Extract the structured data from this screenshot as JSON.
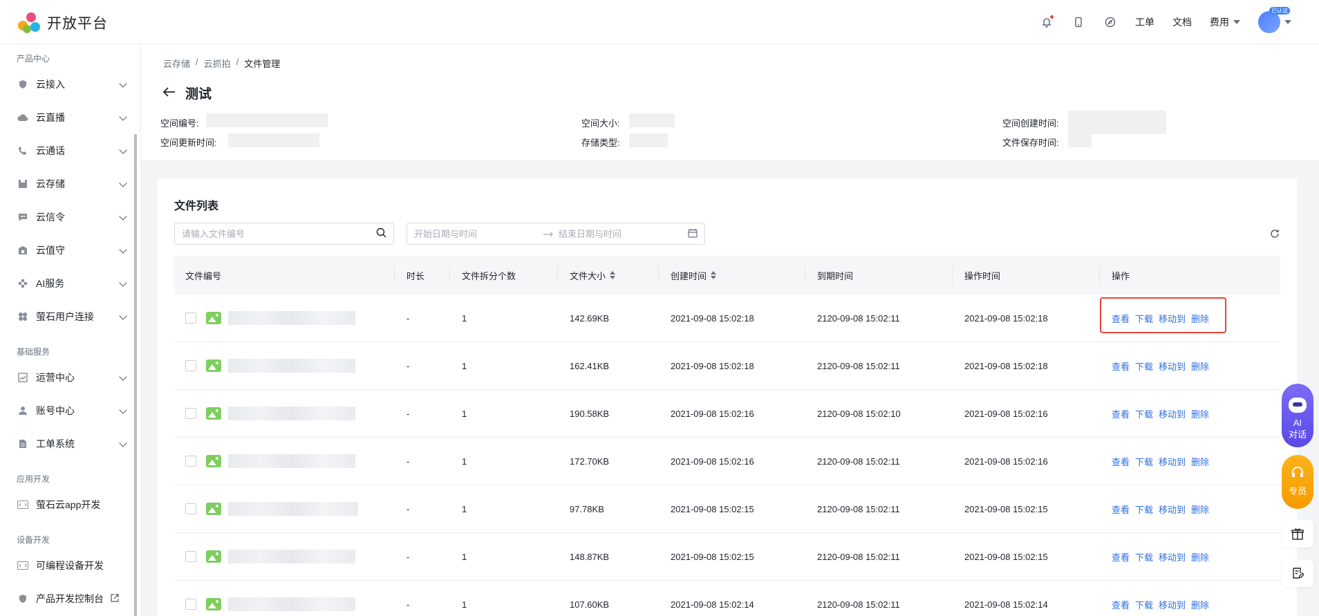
{
  "header": {
    "logo_text": "开放平台",
    "ticket": "工单",
    "docs": "文档",
    "fees": "费用",
    "avatar_badge": "已认证"
  },
  "sidebar": {
    "sections": {
      "product": "产品中心",
      "basic": "基础服务",
      "app": "应用开发",
      "device": "设备开发"
    },
    "items": [
      {
        "label": "云接入",
        "icon": "shield-icon"
      },
      {
        "label": "云直播",
        "icon": "cloud-icon"
      },
      {
        "label": "云通话",
        "icon": "phone-icon"
      },
      {
        "label": "云存储",
        "icon": "save-icon"
      },
      {
        "label": "云信令",
        "icon": "message-icon"
      },
      {
        "label": "云值守",
        "icon": "lock-icon"
      },
      {
        "label": "AI服务",
        "icon": "ai-icon"
      },
      {
        "label": "萤石用户连接",
        "icon": "apps-icon"
      },
      {
        "label": "运营中心",
        "icon": "chart-icon"
      },
      {
        "label": "账号中心",
        "icon": "user-icon"
      },
      {
        "label": "工单系统",
        "icon": "doc-icon"
      },
      {
        "label": "萤石云app开发",
        "icon": "code-icon"
      },
      {
        "label": "可编程设备开发",
        "icon": "code-icon"
      },
      {
        "label": "产品开发控制台",
        "icon": "shield-icon"
      }
    ]
  },
  "breadcrumb": [
    "云存储",
    "云抓拍",
    "文件管理"
  ],
  "page_title": "测试",
  "info": {
    "space_id": "空间编号:",
    "space_size": "空间大小:",
    "space_created": "空间创建时间:",
    "space_updated": "空间更新时间:",
    "storage_type": "存储类型:",
    "file_retention": "文件保存时间:"
  },
  "card": {
    "title": "文件列表",
    "search_placeholder": "请输入文件编号",
    "start_placeholder": "开始日期与时间",
    "end_placeholder": "结束日期与时间"
  },
  "table": {
    "headers": {
      "file_id": "文件编号",
      "duration": "时长",
      "split_count": "文件拆分个数",
      "size": "文件大小",
      "created": "创建时间",
      "expire": "到期时间",
      "op_time": "操作时间",
      "actions": "操作"
    },
    "action_labels": {
      "view": "查看",
      "download": "下载",
      "move": "移动到",
      "delete": "删除"
    },
    "rows": [
      {
        "duration": "-",
        "split": "1",
        "size": "142.69KB",
        "created": "2021-09-08 15:02:18",
        "expire": "2120-09-08 15:02:11",
        "op": "2021-09-08 15:02:18"
      },
      {
        "duration": "-",
        "split": "1",
        "size": "162.41KB",
        "created": "2021-09-08 15:02:18",
        "expire": "2120-09-08 15:02:11",
        "op": "2021-09-08 15:02:18"
      },
      {
        "duration": "-",
        "split": "1",
        "size": "190.58KB",
        "created": "2021-09-08 15:02:16",
        "expire": "2120-09-08 15:02:10",
        "op": "2021-09-08 15:02:16"
      },
      {
        "duration": "-",
        "split": "1",
        "size": "172.70KB",
        "created": "2021-09-08 15:02:16",
        "expire": "2120-09-08 15:02:11",
        "op": "2021-09-08 15:02:16"
      },
      {
        "duration": "-",
        "split": "1",
        "size": "97.78KB",
        "created": "2021-09-08 15:02:15",
        "expire": "2120-09-08 15:02:11",
        "op": "2021-09-08 15:02:15"
      },
      {
        "duration": "-",
        "split": "1",
        "size": "148.87KB",
        "created": "2021-09-08 15:02:15",
        "expire": "2120-09-08 15:02:11",
        "op": "2021-09-08 15:02:15"
      },
      {
        "duration": "-",
        "split": "1",
        "size": "107.60KB",
        "created": "2021-09-08 15:02:14",
        "expire": "2120-09-08 15:02:11",
        "op": "2021-09-08 15:02:14"
      }
    ]
  },
  "floating": {
    "ai_line1": "AI",
    "ai_line2": "对话",
    "service": "专员"
  },
  "colors": {
    "accent": "#2f6fe4",
    "highlight": "#e8423a",
    "ai": "#6a5af0",
    "service": "#f7a30a"
  }
}
